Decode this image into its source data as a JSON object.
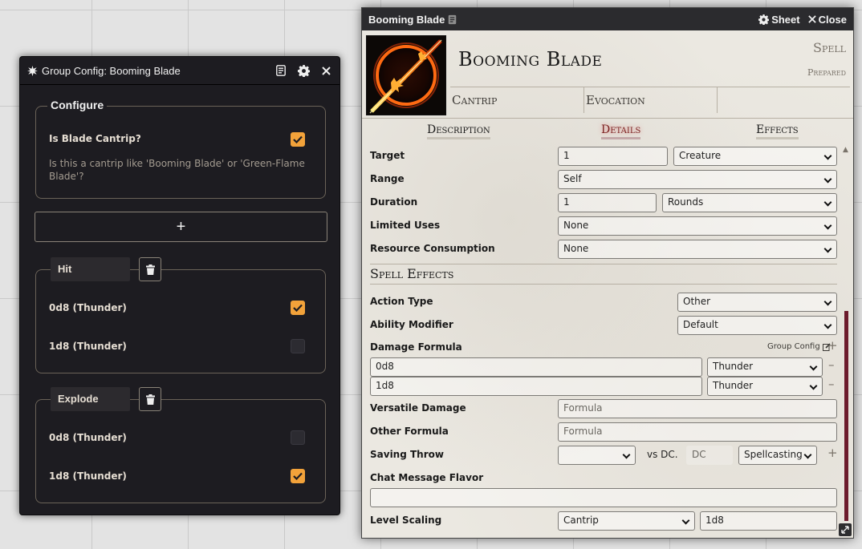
{
  "group_config": {
    "title": "Group Config: Booming Blade",
    "configure": {
      "legend": "Configure",
      "is_blade_label": "Is Blade Cantrip?",
      "is_blade_checked": true,
      "hint": "Is this a cantrip like 'Booming Blade' or 'Green-Flame Blade'?"
    },
    "add_label": "+",
    "groups": [
      {
        "name": "Hit",
        "rows": [
          {
            "label": "0d8 (Thunder)",
            "checked": true
          },
          {
            "label": "1d8 (Thunder)",
            "checked": false
          }
        ]
      },
      {
        "name": "Explode",
        "rows": [
          {
            "label": "0d8 (Thunder)",
            "checked": false
          },
          {
            "label": "1d8 (Thunder)",
            "checked": true
          }
        ]
      }
    ],
    "icons": {
      "window": "burst-icon",
      "journal": "journal-icon",
      "settings": "gear-icon",
      "close": "close-icon"
    }
  },
  "sheet": {
    "window_title": "Booming Blade",
    "sheet_btn": "Sheet",
    "close_btn": "Close",
    "item_name": "Booming Blade",
    "item_type": "Spell",
    "item_status": "Prepared",
    "summary": [
      "Cantrip",
      "Evocation",
      ""
    ],
    "tabs": [
      "Description",
      "Details",
      "Effects"
    ],
    "active_tab": "Details",
    "fields": {
      "target_label": "Target",
      "target_value": "1",
      "target_type": "Creature",
      "range_label": "Range",
      "range_value": "Self",
      "duration_label": "Duration",
      "duration_value": "1",
      "duration_units": "Rounds",
      "limited_uses_label": "Limited Uses",
      "limited_uses_value": "None",
      "resource_label": "Resource Consumption",
      "resource_value": "None"
    },
    "spell_effects": {
      "title": "Spell Effects",
      "action_type_label": "Action Type",
      "action_type_value": "Other",
      "ability_label": "Ability Modifier",
      "ability_value": "Default",
      "damage_label": "Damage Formula",
      "group_config_link": "Group Config",
      "damage_parts": [
        {
          "formula": "0d8",
          "type": "Thunder"
        },
        {
          "formula": "1d8",
          "type": "Thunder"
        }
      ],
      "versatile_label": "Versatile Damage",
      "versatile_placeholder": "Formula",
      "other_label": "Other Formula",
      "other_placeholder": "Formula",
      "save_label": "Saving Throw",
      "save_ability": "",
      "vs_dc": "vs DC.",
      "dc_placeholder": "DC",
      "dc_scaling": "Spellcasting",
      "flavor_label": "Chat Message Flavor",
      "flavor_value": "",
      "scaling_label": "Level Scaling",
      "scaling_mode": "Cantrip",
      "scaling_formula": "1d8"
    },
    "colors": {
      "active_tab": "#7a1e1e",
      "checkbox": "#f2a23a",
      "scrollbar": "#6c1b2c"
    }
  }
}
